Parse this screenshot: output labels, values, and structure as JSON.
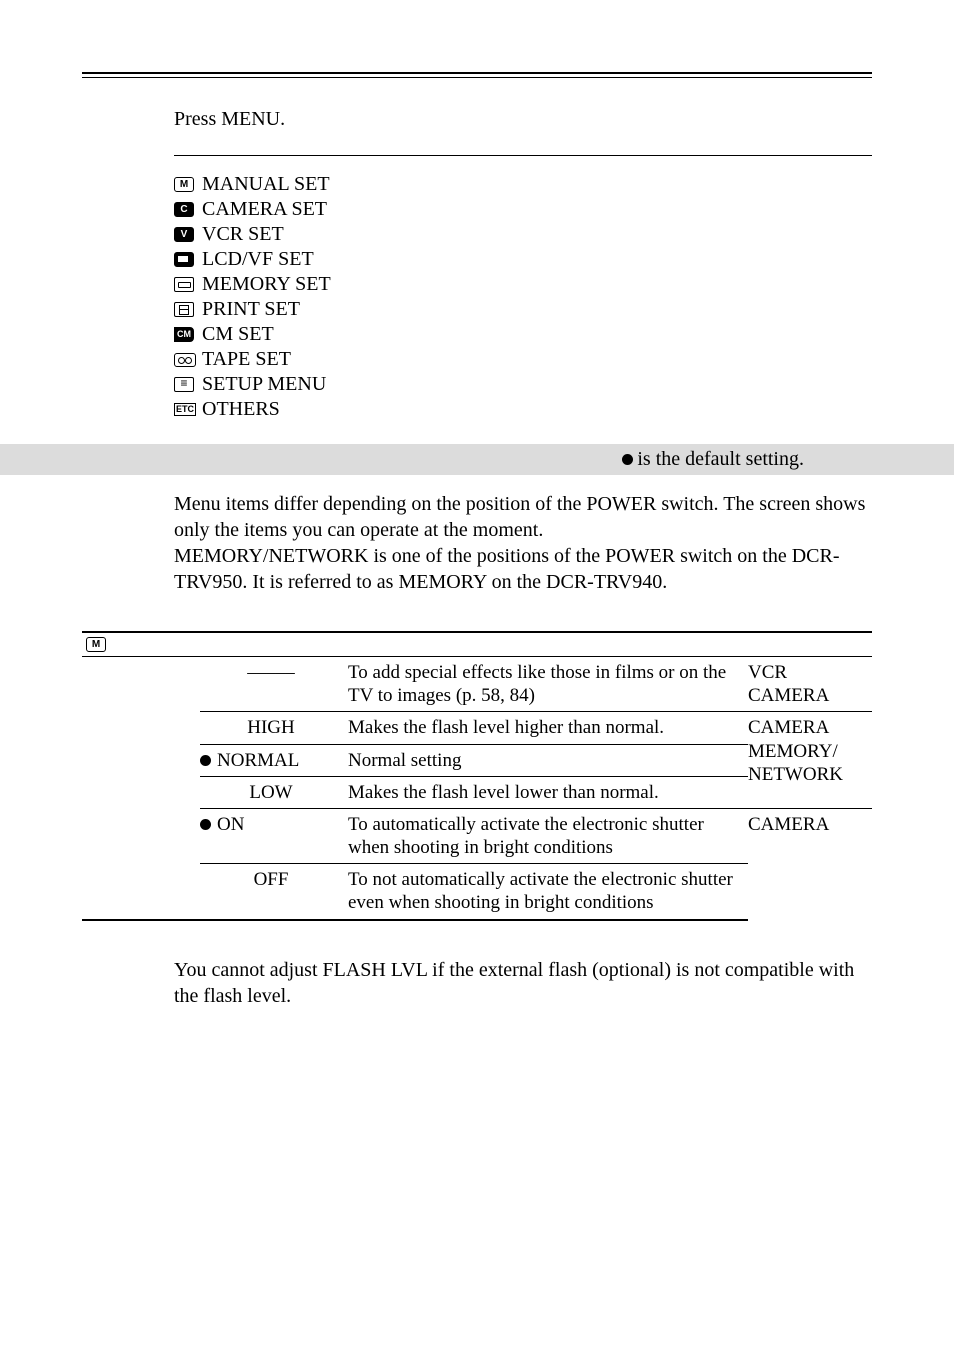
{
  "intro": "Press MENU.",
  "iconsTitle": "",
  "iconList": {
    "items": [
      {
        "code": "M",
        "label": "MANUAL SET"
      },
      {
        "code": "C",
        "label": "CAMERA SET"
      },
      {
        "code": "V",
        "label": "VCR SET"
      },
      {
        "code": "LCD",
        "label": "LCD/VF SET"
      },
      {
        "code": "MEM",
        "label": "MEMORY SET"
      },
      {
        "code": "PRN",
        "label": "PRINT SET"
      },
      {
        "code": "CM",
        "label": "CM SET"
      },
      {
        "code": "TAPE",
        "label": "TAPE SET"
      },
      {
        "code": "SETUP",
        "label": "SETUP MENU"
      },
      {
        "code": "ETC",
        "label": "OTHERS"
      }
    ]
  },
  "defaultNote": " is the default setting.",
  "paragraph": {
    "line1": "Menu items differ depending on the position of the POWER switch. The screen shows only the items you can operate at the moment.",
    "line2": "MEMORY/NETWORK is one of the positions of the POWER switch on the DCR-TRV950. It is referred to as MEMORY on the DCR-TRV940."
  },
  "tableHeadIcon": "M",
  "rows": {
    "r1": {
      "item": "",
      "mode": "–––––",
      "desc": "To add special effects like those in films or on the TV to images (p. 58, 84)",
      "power1": "VCR",
      "power2": "CAMERA"
    },
    "r2a": {
      "mode": "HIGH",
      "desc": "Makes the flash level higher than normal.",
      "power": "CAMERA"
    },
    "r2b": {
      "mode": "NORMAL",
      "desc": "Normal setting",
      "power": "MEMORY/"
    },
    "r2c": {
      "mode": "LOW",
      "desc": "Makes the flash level lower than normal.",
      "power": "NETWORK"
    },
    "r3a": {
      "mode": "ON",
      "desc": "To automatically activate the electronic shutter when shooting in bright conditions",
      "power": "CAMERA"
    },
    "r3b": {
      "mode": "OFF",
      "desc": "To not automatically activate the electronic shutter even when shooting in bright conditions"
    }
  },
  "note": "You cannot adjust FLASH LVL if the external flash (optional) is not compatible with the flash level."
}
